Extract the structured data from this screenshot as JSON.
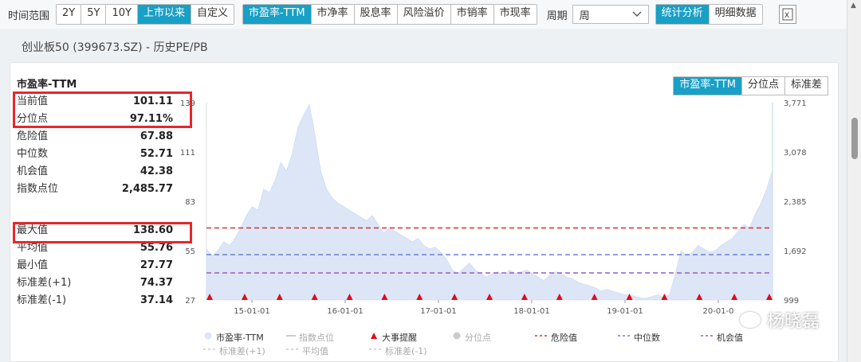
{
  "toolbar": {
    "time_label": "时间范围",
    "time_buttons": [
      "2Y",
      "5Y",
      "10Y",
      "上市以来",
      "自定义"
    ],
    "time_active": 3,
    "metric_buttons": [
      "市盈率-TTM",
      "市净率",
      "股息率",
      "风险溢价",
      "市销率",
      "市现率"
    ],
    "metric_active": 0,
    "period_label": "周期",
    "period_value": "周",
    "view_buttons": [
      "统计分析",
      "明细数据"
    ],
    "view_active": 0,
    "export_icon": "excel-export-icon"
  },
  "page_title": "创业板50 (399673.SZ) - 历史PE/PB",
  "stats": {
    "title": "市盈率-TTM",
    "rows_a": [
      {
        "label": "当前值",
        "value": "101.11"
      },
      {
        "label": "分位点",
        "value": "97.11%"
      },
      {
        "label": "危险值",
        "value": "67.88"
      },
      {
        "label": "中位数",
        "value": "52.71"
      },
      {
        "label": "机会值",
        "value": "42.38"
      },
      {
        "label": "指数点位",
        "value": "2,485.77"
      }
    ],
    "rows_b": [
      {
        "label": "最大值",
        "value": "138.60"
      },
      {
        "label": "平均值",
        "value": "55.76"
      },
      {
        "label": "最小值",
        "value": "27.77"
      },
      {
        "label": "标准差(+1)",
        "value": "74.37"
      },
      {
        "label": "标准差(-1)",
        "value": "37.14"
      }
    ]
  },
  "chart_tabs": [
    "市盈率-TTM",
    "分位点",
    "标准差"
  ],
  "chart_tabs_active": 0,
  "chart_data": {
    "type": "area",
    "x_ticks": [
      "15-01-01",
      "16-01-01",
      "17-01-01",
      "18-01-01",
      "19-01-01",
      "20-01-0"
    ],
    "y_left_ticks": [
      "139",
      "111",
      "83",
      "55",
      "27"
    ],
    "y_right_ticks": [
      "3,771",
      "3,078",
      "2,385",
      "1,692",
      "999"
    ],
    "ylim_left": [
      27,
      139
    ],
    "pe_series": [
      56,
      52,
      55,
      60,
      58,
      62,
      68,
      75,
      80,
      78,
      90,
      88,
      95,
      105,
      100,
      110,
      125,
      132,
      138,
      120,
      100,
      90,
      85,
      82,
      80,
      78,
      76,
      74,
      72,
      75,
      70,
      65,
      68,
      66,
      64,
      62,
      60,
      62,
      58,
      56,
      57,
      54,
      50,
      44,
      42,
      45,
      48,
      44,
      42,
      40,
      42,
      43,
      41,
      44,
      42,
      43,
      44,
      42,
      40,
      38,
      41,
      43,
      42,
      40,
      39,
      37,
      36,
      35,
      34,
      32,
      33,
      32,
      31,
      30,
      30,
      29,
      28,
      28,
      29,
      30,
      28,
      30,
      42,
      55,
      52,
      54,
      58,
      56,
      54,
      55,
      58,
      60,
      62,
      66,
      70,
      68,
      76,
      82,
      90,
      101
    ],
    "danger": 67.88,
    "median": 52.71,
    "chance": 42.38,
    "event_markers": 17,
    "colors": {
      "area": "#dce6f7",
      "danger": "#d9302e",
      "median": "#6d7fd9",
      "chance": "#9b59c8",
      "marker": "#e10a1c"
    }
  },
  "legend": [
    {
      "label": "市盈率-TTM",
      "dim": false,
      "icon": "circle"
    },
    {
      "label": "指数点位",
      "dim": true,
      "icon": "line"
    },
    {
      "label": "大事提醒",
      "dim": false,
      "icon": "triangle"
    },
    {
      "label": "分位点",
      "dim": true,
      "icon": "circle"
    },
    {
      "label": "危险值",
      "dim": false,
      "icon": "dash-red"
    },
    {
      "label": "中位数",
      "dim": false,
      "icon": "dash-blue"
    },
    {
      "label": "机会值",
      "dim": false,
      "icon": "dash-purple"
    },
    {
      "label": "标准差(+1)",
      "dim": true,
      "icon": "dash-gray"
    },
    {
      "label": "平均值",
      "dim": true,
      "icon": "dash-gray"
    },
    {
      "label": "标准差(-1)",
      "dim": true,
      "icon": "dash-gray"
    }
  ],
  "watermark": "杨晓磊"
}
